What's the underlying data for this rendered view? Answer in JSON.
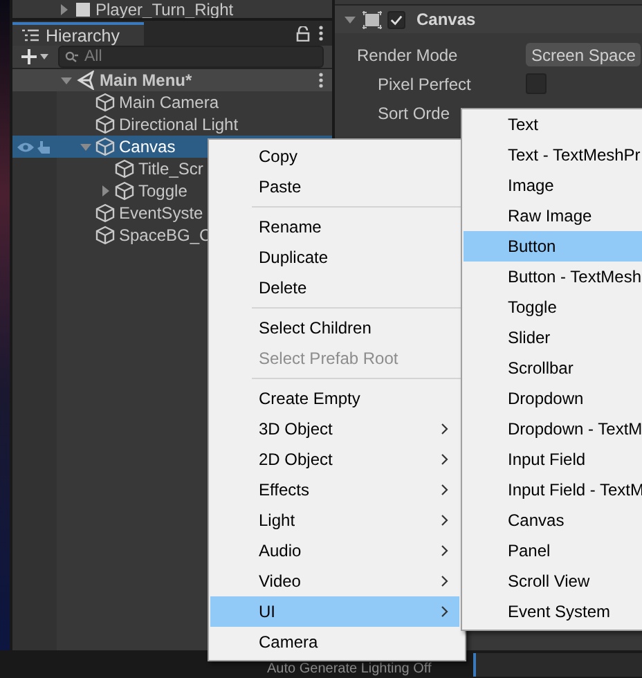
{
  "scene_strip": {
    "row": "Player_Turn_Right"
  },
  "hierarchy": {
    "tab": "Hierarchy",
    "search": {
      "placeholder": "All"
    },
    "items": [
      {
        "label": "Main Menu*",
        "kind": "scene",
        "expanded": true,
        "selected": false,
        "children": [
          {
            "label": "Main Camera",
            "kind": "object",
            "selected": false
          },
          {
            "label": "Directional Light",
            "kind": "object",
            "selected": false
          },
          {
            "label": "Canvas",
            "kind": "object",
            "expanded": true,
            "selected": true,
            "children": [
              {
                "label": "Title_Scr",
                "kind": "object",
                "selected": false
              },
              {
                "label": "Toggle",
                "kind": "object",
                "expanded": false,
                "selected": false
              }
            ]
          },
          {
            "label": "EventSyste",
            "kind": "object",
            "selected": false
          },
          {
            "label": "SpaceBG_C",
            "kind": "object",
            "selected": false
          }
        ]
      }
    ]
  },
  "inspector": {
    "component": {
      "title": "Canvas",
      "enabled": true,
      "expanded": true
    },
    "fields": [
      {
        "label": "Render Mode",
        "kind": "dropdown",
        "value": "Screen Space"
      },
      {
        "label": "Pixel Perfect",
        "kind": "checkbox",
        "checked": false
      },
      {
        "label": "Sort Orde",
        "kind": "plain"
      }
    ]
  },
  "context_menu": {
    "items": [
      {
        "kind": "item",
        "label": "Copy",
        "selected": false
      },
      {
        "kind": "item",
        "label": "Paste",
        "selected": false
      },
      {
        "kind": "separator"
      },
      {
        "kind": "item",
        "label": "Rename",
        "selected": false
      },
      {
        "kind": "item",
        "label": "Duplicate",
        "selected": false
      },
      {
        "kind": "item",
        "label": "Delete",
        "selected": false
      },
      {
        "kind": "separator"
      },
      {
        "kind": "item",
        "label": "Select Children",
        "selected": false
      },
      {
        "kind": "item",
        "label": "Select Prefab Root",
        "disabled": true,
        "selected": false
      },
      {
        "kind": "separator"
      },
      {
        "kind": "item",
        "label": "Create Empty",
        "selected": false
      },
      {
        "kind": "item",
        "label": "3D Object",
        "submenu": true,
        "selected": false
      },
      {
        "kind": "item",
        "label": "2D Object",
        "submenu": true,
        "selected": false
      },
      {
        "kind": "item",
        "label": "Effects",
        "submenu": true,
        "selected": false
      },
      {
        "kind": "item",
        "label": "Light",
        "submenu": true,
        "selected": false
      },
      {
        "kind": "item",
        "label": "Audio",
        "submenu": true,
        "selected": false
      },
      {
        "kind": "item",
        "label": "Video",
        "submenu": true,
        "selected": false
      },
      {
        "kind": "item",
        "label": "UI",
        "submenu": true,
        "selected": true
      },
      {
        "kind": "item",
        "label": "Camera",
        "selected": false
      }
    ]
  },
  "submenu": {
    "items": [
      {
        "label": "Text",
        "selected": false
      },
      {
        "label": "Text - TextMeshPr",
        "selected": false
      },
      {
        "label": "Image",
        "selected": false
      },
      {
        "label": "Raw Image",
        "selected": false
      },
      {
        "label": "Button",
        "selected": true
      },
      {
        "label": "Button - TextMesh",
        "selected": false
      },
      {
        "label": "Toggle",
        "selected": false
      },
      {
        "label": "Slider",
        "selected": false
      },
      {
        "label": "Scrollbar",
        "selected": false
      },
      {
        "label": "Dropdown",
        "selected": false
      },
      {
        "label": "Dropdown - TextM",
        "selected": false
      },
      {
        "label": "Input Field",
        "selected": false
      },
      {
        "label": "Input Field - TextM",
        "selected": false
      },
      {
        "label": "Canvas",
        "selected": false
      },
      {
        "label": "Panel",
        "selected": false
      },
      {
        "label": "Scroll View",
        "selected": false
      },
      {
        "label": "Event System",
        "selected": false
      }
    ]
  },
  "status_bar": {
    "text": "Auto Generate Lighting Off"
  }
}
